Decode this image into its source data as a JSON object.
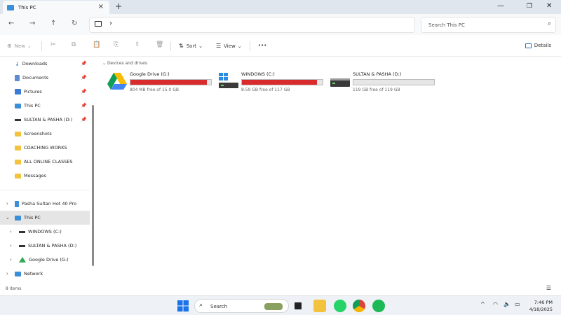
{
  "tab": {
    "title": "This PC",
    "icon": "monitor-icon"
  },
  "toolbar": {
    "new_label": "New",
    "sort_label": "Sort",
    "view_label": "View",
    "more_label": "•••",
    "details_label": "Details"
  },
  "address": {
    "search_placeholder": "Search This PC"
  },
  "sidebar": {
    "quick_access": [
      {
        "label": "Downloads",
        "icon": "download-icon",
        "pinned": true
      },
      {
        "label": "Documents",
        "icon": "document-icon",
        "pinned": true
      },
      {
        "label": "Pictures",
        "icon": "pictures-icon",
        "pinned": true
      },
      {
        "label": "This PC",
        "icon": "monitor-icon",
        "pinned": true
      },
      {
        "label": "SULTAN & PASHA (D:)",
        "icon": "drive-icon",
        "pinned": true
      },
      {
        "label": "Screenshots",
        "icon": "folder-icon",
        "pinned": false
      },
      {
        "label": "COACHING WORKS",
        "icon": "folder-icon",
        "pinned": false
      },
      {
        "label": "ALL ONLINE CLASSES",
        "icon": "folder-icon",
        "pinned": false
      },
      {
        "label": "Messages",
        "icon": "folder-icon",
        "pinned": false
      }
    ],
    "tree": [
      {
        "label": "Pasha Sultan Hot 40 Pro",
        "icon": "phone-icon",
        "level": 0,
        "expanded": false
      },
      {
        "label": "This PC",
        "icon": "monitor-icon",
        "level": 0,
        "expanded": true,
        "selected": true
      },
      {
        "label": "WINDOWS (C:)",
        "icon": "windows-drive-icon",
        "level": 1,
        "expanded": false
      },
      {
        "label": "SULTAN & PASHA (D:)",
        "icon": "drive-icon",
        "level": 1,
        "expanded": false
      },
      {
        "label": "Google Drive (G:)",
        "icon": "google-drive-icon",
        "level": 1,
        "expanded": false
      },
      {
        "label": "Network",
        "icon": "network-icon",
        "level": 0,
        "expanded": false
      }
    ]
  },
  "main": {
    "section_title": "Devices and drives",
    "drives": [
      {
        "name": "Google Drive (G:)",
        "free_text": "804 MB free of 15.0 GB",
        "used_fraction": 0.95,
        "bar_color": "#d92b2b",
        "icon": "google-drive-icon"
      },
      {
        "name": "WINDOWS (C:)",
        "free_text": "8.59 GB free of 117 GB",
        "used_fraction": 0.93,
        "bar_color": "#d92b2b",
        "icon": "windows-drive-icon"
      },
      {
        "name": "SULTAN & PASHA (D:)",
        "free_text": "119 GB free of 119 GB",
        "used_fraction": 0.0,
        "bar_color": "#2a6fb7",
        "icon": "drive-icon"
      }
    ]
  },
  "status": {
    "item_count": "8 items"
  },
  "taskbar": {
    "search_placeholder": "Search",
    "time": "7:46 PM",
    "date": "4/18/2025"
  }
}
